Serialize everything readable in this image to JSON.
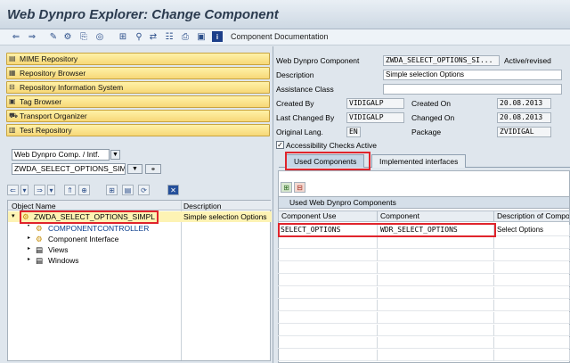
{
  "window": {
    "title": "Web Dynpro Explorer: Change Component"
  },
  "toolbar": {
    "component_doc_label": "Component Documentation"
  },
  "nav": [
    {
      "label": "MIME Repository",
      "icon": "folder-icon"
    },
    {
      "label": "Repository Browser",
      "icon": "browser-icon"
    },
    {
      "label": "Repository Information System",
      "icon": "info-system-icon"
    },
    {
      "label": "Tag Browser",
      "icon": "tag-icon"
    },
    {
      "label": "Transport Organizer",
      "icon": "truck-icon"
    },
    {
      "label": "Test Repository",
      "icon": "test-icon"
    }
  ],
  "object_type": {
    "value": "Web Dynpro Comp. / Intf."
  },
  "object_name": {
    "value": "ZWDA_SELECT_OPTIONS_SIM"
  },
  "tree": {
    "col_object": "Object Name",
    "col_desc": "Description",
    "rows": [
      {
        "label": "ZWDA_SELECT_OPTIONS_SIMPL",
        "desc": "Simple selection Options"
      },
      {
        "label": "COMPONENTCONTROLLER",
        "desc": ""
      },
      {
        "label": "Component Interface",
        "desc": ""
      },
      {
        "label": "Views",
        "desc": ""
      },
      {
        "label": "Windows",
        "desc": ""
      }
    ]
  },
  "form": {
    "component_label": "Web Dynpro Component",
    "component_value": "ZWDA_SELECT_OPTIONS_SI...",
    "status": "Active/revised",
    "description_label": "Description",
    "description_value": "Simple selection Options",
    "assistance_label": "Assistance Class",
    "assistance_value": "",
    "created_by_label": "Created By",
    "created_by_value": "VIDIGALP",
    "created_on_label": "Created On",
    "created_on_value": "20.08.2013",
    "changed_by_label": "Last Changed By",
    "changed_by_value": "VIDIGALP",
    "changed_on_label": "Changed On",
    "changed_on_value": "20.08.2013",
    "lang_label": "Original Lang.",
    "lang_value": "EN",
    "package_label": "Package",
    "package_value": "ZVIDIGAL",
    "accessibility_label": "Accessibility Checks Active",
    "accessibility_checked": true
  },
  "tabs": [
    {
      "label": "Used Components",
      "active": true
    },
    {
      "label": "Implemented interfaces",
      "active": false
    }
  ],
  "components_table": {
    "title": "Used Web Dynpro Components",
    "columns": [
      "Component Use",
      "Component",
      "Description of Compo"
    ],
    "rows": [
      {
        "use": "SELECT_OPTIONS",
        "component": "WDR_SELECT_OPTIONS",
        "desc": "Select Options"
      }
    ]
  },
  "colors": {
    "highlight_red": "#e0242c",
    "nav_button": "#f7d878",
    "tree_highlight": "#fdf3b4"
  }
}
